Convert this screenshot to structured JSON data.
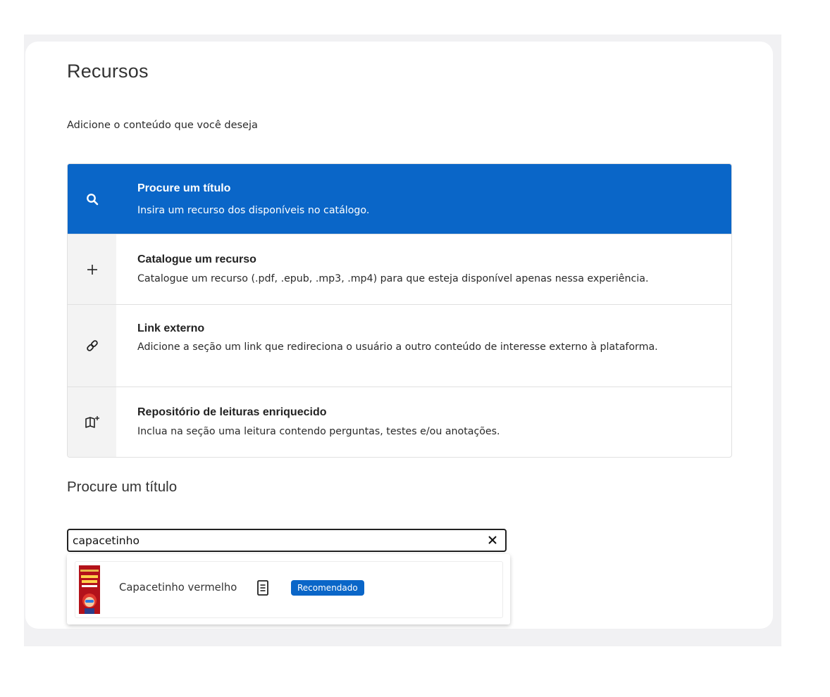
{
  "header": {
    "title": "Recursos",
    "subtitle": "Adicione o conteúdo que você deseja"
  },
  "options": [
    {
      "icon": "search-icon",
      "title": "Procure um título",
      "description": "Insira um recurso dos disponíveis no catálogo.",
      "selected": true
    },
    {
      "icon": "plus-icon",
      "title": "Catalogue um recurso",
      "description": "Catalogue um recurso (.pdf, .epub, .mp3, .mp4) para que esteja disponível apenas nessa experiência.",
      "selected": false
    },
    {
      "icon": "link-icon",
      "title": "Link externo",
      "description": "Adicione a seção um link que redireciona o usuário a outro conteúdo de interesse externo à plataforma.",
      "selected": false
    },
    {
      "icon": "book-add-icon",
      "title": "Repositório de leituras enriquecido",
      "description": "Inclua na seção uma leitura contendo perguntas, testes e/ou anotações.",
      "selected": false
    }
  ],
  "search_section": {
    "title": "Procure um título",
    "input_value": "capacetinho"
  },
  "results": [
    {
      "title": "Capacetinho vermelho",
      "type_icon": "document-icon",
      "badge": "Recomendado",
      "cover_icon": "book-cover-thumbnail"
    }
  ],
  "colors": {
    "accent": "#0a66c8",
    "card_background": "#ffffff",
    "page_background": "#f1f1f3",
    "icon_column": "#f3f3f3"
  }
}
